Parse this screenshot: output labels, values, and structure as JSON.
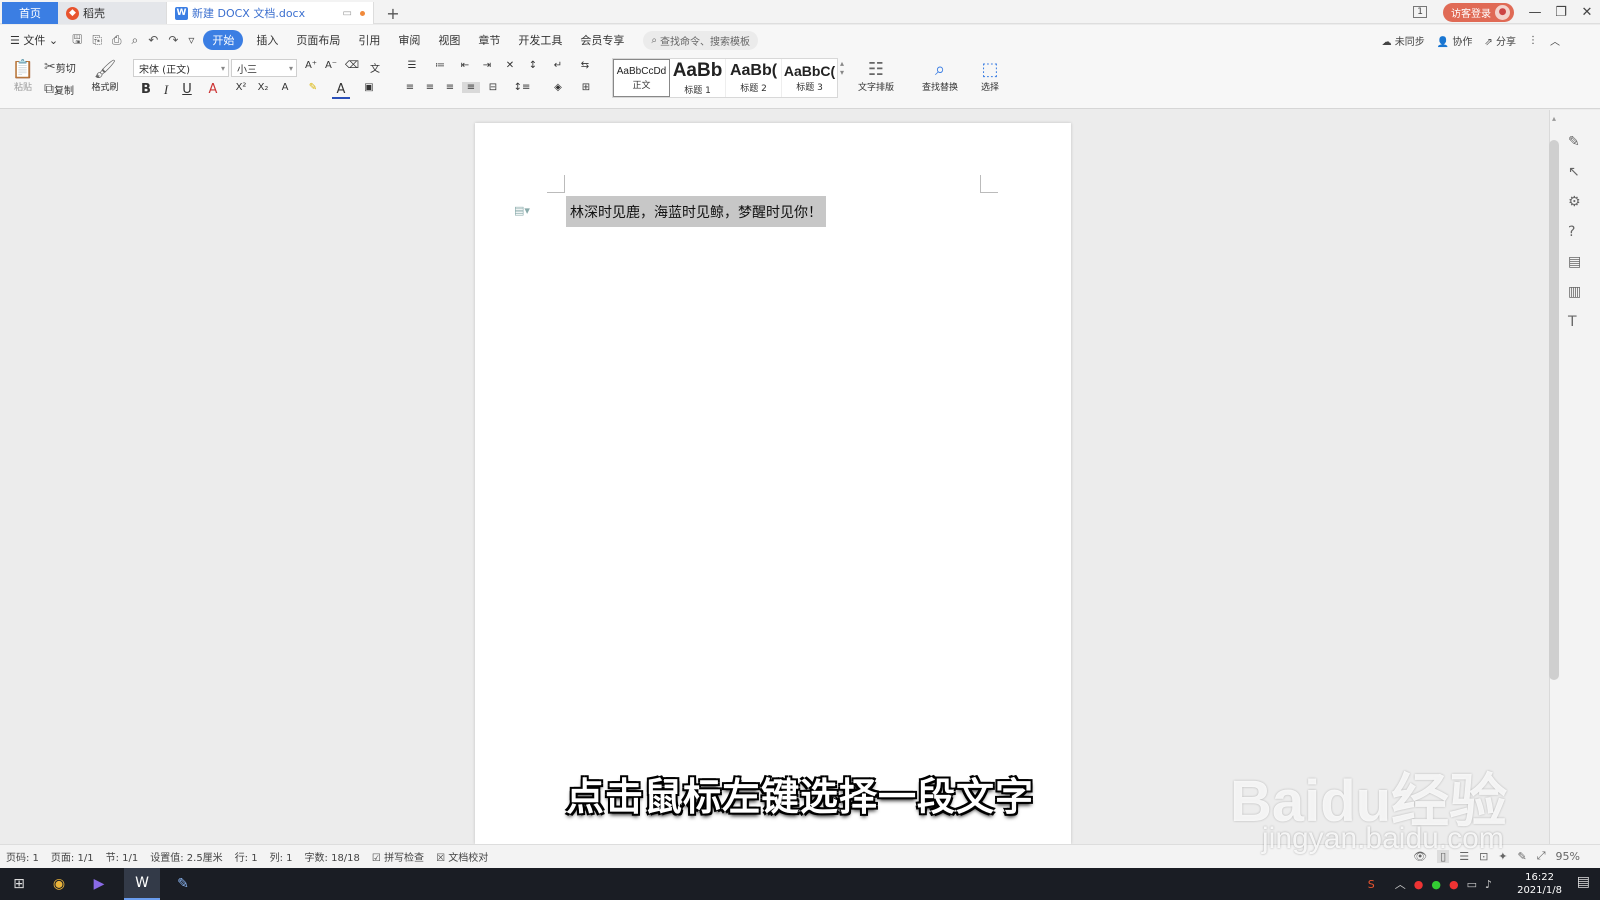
{
  "tabs": {
    "home": "首页",
    "daoke": "稻壳",
    "document": "新建 DOCX 文档.docx",
    "add": "+"
  },
  "window": {
    "page_count_badge": "1",
    "login": "访客登录",
    "minimize": "—",
    "restore": "❐",
    "close": "✕"
  },
  "menu": {
    "file": "文件",
    "items": [
      "开始",
      "插入",
      "页面布局",
      "引用",
      "审阅",
      "视图",
      "章节",
      "开发工具",
      "会员专享"
    ],
    "active": "开始",
    "search_placeholder": "查找命令、搜索模板",
    "sync": "未同步",
    "collab": "协作",
    "share": "分享"
  },
  "ribbon": {
    "paste": "粘贴",
    "cut": "剪切",
    "copy": "复制",
    "format_painter": "格式刷",
    "font_name": "宋体 (正文)",
    "font_size": "小三",
    "styles": [
      {
        "preview": "AaBbCcDd",
        "label": "正文"
      },
      {
        "preview": "AaBb",
        "label": "标题 1"
      },
      {
        "preview": "AaBb(",
        "label": "标题 2"
      },
      {
        "preview": "AaBbC(",
        "label": "标题 3"
      }
    ],
    "text_layout": "文字排版",
    "find_replace": "查找替换",
    "select": "选择"
  },
  "document": {
    "selected_text": "林深时见鹿，海蓝时见鲸，梦醒时见你！"
  },
  "statusbar": {
    "page_no": "页码: 1",
    "pages": "页面: 1/1",
    "section": "节: 1/1",
    "setting": "设置值: 2.5厘米",
    "row": "行: 1",
    "col": "列: 1",
    "word_count": "字数: 18/18",
    "spell_check": "拼写检查",
    "doc_proof": "文档校对",
    "zoom": "95%"
  },
  "taskbar": {
    "time": "16:22",
    "date": "2021/1/8"
  },
  "overlay": {
    "subtitle": "点击鼠标左键选择一段文字",
    "watermark": "Baidu经验",
    "watermark_url": "jingyan.baidu.com"
  },
  "colors": {
    "accent": "#3b7ee3",
    "login": "#e06a55",
    "selection": "#c7c7c7"
  }
}
